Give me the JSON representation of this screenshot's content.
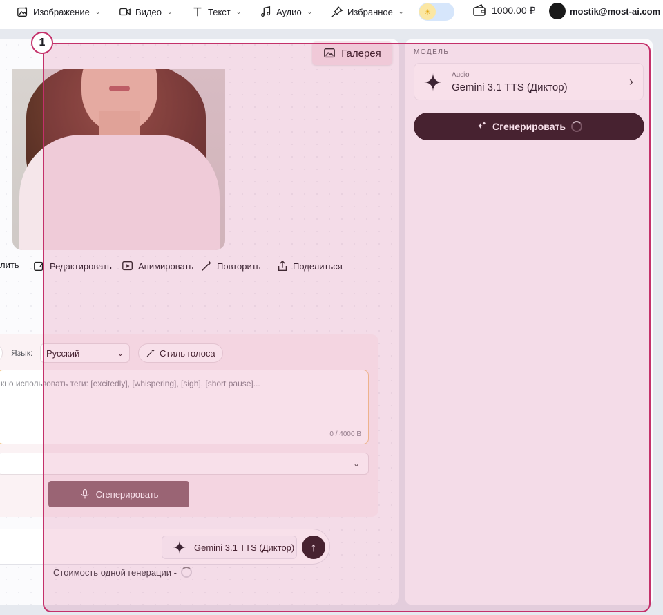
{
  "topbar": {
    "nav": [
      {
        "label": "Изображение",
        "icon": "image-sparkle-icon"
      },
      {
        "label": "Видео",
        "icon": "video-icon"
      },
      {
        "label": "Текст",
        "icon": "text-icon"
      },
      {
        "label": "Аудио",
        "icon": "music-note-icon"
      },
      {
        "label": "Избранное",
        "icon": "pin-icon"
      }
    ],
    "theme_toggle_icon": "sun-icon",
    "balance": "1000.00 ₽",
    "user_email": "mostik@most-ai.com"
  },
  "main": {
    "gallery_label": "Галерея",
    "actions": [
      {
        "label": "лить",
        "icon": "delete-icon"
      },
      {
        "label": "Редактировать",
        "icon": "edit-image-icon"
      },
      {
        "label": "Анимировать",
        "icon": "animate-icon"
      },
      {
        "label": "Повторить",
        "icon": "magic-wand-icon"
      },
      {
        "label": "Поделиться",
        "icon": "share-icon"
      }
    ],
    "tts": {
      "lang_label": "Язык:",
      "lang_value": "Русский",
      "voice_style_label": "Стиль голоса",
      "textarea_placeholder": "кно использовать теги: [excitedly], [whispering], [sigh], [short pause]...",
      "counter": "0 / 4000 B",
      "generate_label": "Сгенерировать"
    },
    "prompt": {
      "model_chip": "Gemini 3.1 TTS (Диктор)",
      "cost_label": "Стоимость одной генерации -"
    }
  },
  "right": {
    "section_label": "МОДЕЛЬ",
    "model_category": "Audio",
    "model_name": "Gemini 3.1 TTS (Диктор)",
    "generate_label": "Сгенерировать"
  },
  "overlay": {
    "badge": "1",
    "color": "#c4306a"
  }
}
